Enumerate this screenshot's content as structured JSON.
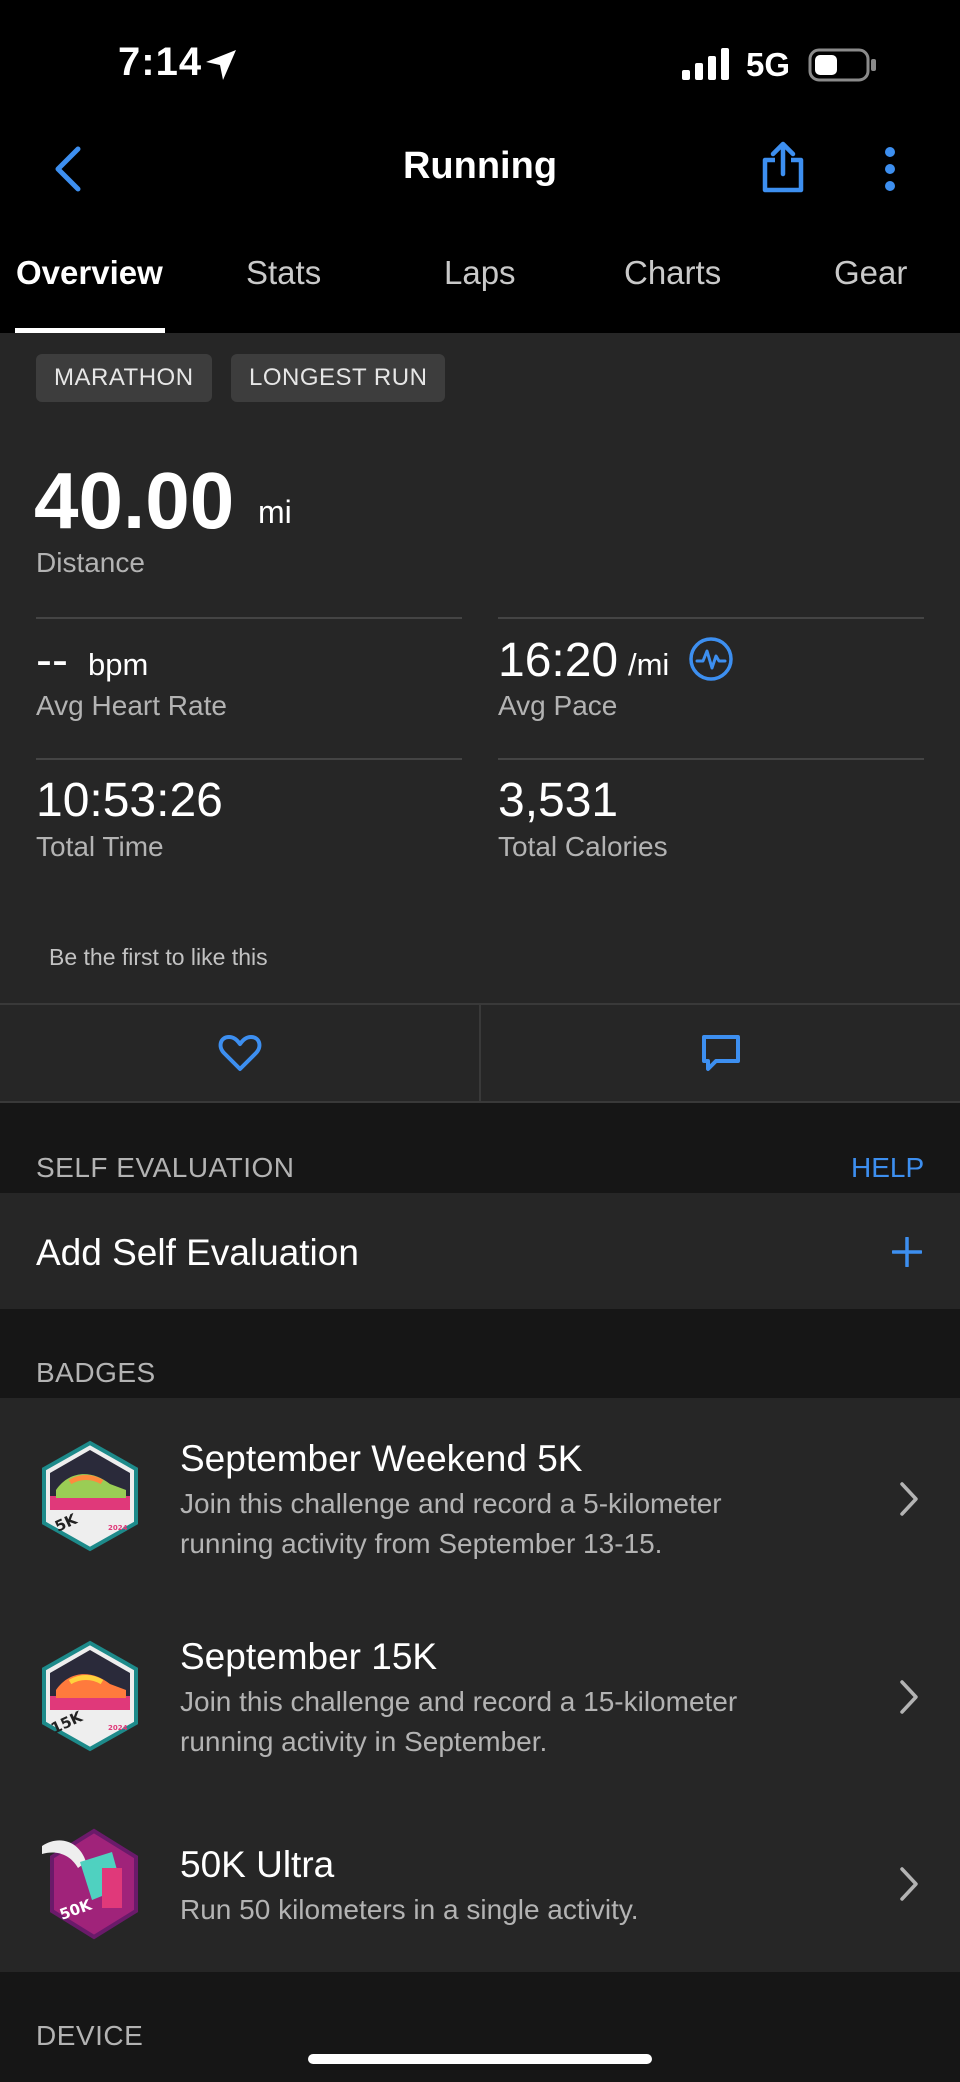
{
  "status_bar": {
    "time": "7:14",
    "network": "5G"
  },
  "header": {
    "title": "Running"
  },
  "tabs": [
    {
      "label": "Overview",
      "active": true
    },
    {
      "label": "Stats"
    },
    {
      "label": "Laps"
    },
    {
      "label": "Charts"
    },
    {
      "label": "Gear"
    }
  ],
  "chips": [
    "MARATHON",
    "LONGEST RUN"
  ],
  "distance": {
    "value": "40.00",
    "unit": "mi",
    "label": "Distance"
  },
  "stats": {
    "heart_rate": {
      "value": "--",
      "unit": "bpm",
      "label": "Avg Heart Rate"
    },
    "pace": {
      "value": "16:20",
      "unit": "/mi",
      "label": "Avg Pace"
    },
    "time": {
      "value": "10:53:26",
      "label": "Total Time"
    },
    "calories": {
      "value": "3,531",
      "label": "Total Calories"
    }
  },
  "social": {
    "likes_text": "Be the first to like this"
  },
  "self_evaluation": {
    "header": "SELF EVALUATION",
    "help": "HELP",
    "add_label": "Add Self Evaluation"
  },
  "badges": {
    "header": "BADGES",
    "items": [
      {
        "title": "September Weekend 5K",
        "line1": "Join this challenge and record a 5-kilometer",
        "line2": "running activity from September 13-15.",
        "icon": "5K",
        "year": "2024"
      },
      {
        "title": "September 15K",
        "line1": "Join this challenge and record a 15-kilometer",
        "line2": "running activity in September.",
        "icon": "15K",
        "year": "2024"
      },
      {
        "title": "50K Ultra",
        "line1": "Run 50 kilometers in a single activity.",
        "line2": "",
        "icon": "50K"
      }
    ]
  },
  "device": {
    "header": "DEVICE"
  },
  "colors": {
    "accent": "#3d8ff0",
    "background": "#161616",
    "card": "#262626"
  }
}
